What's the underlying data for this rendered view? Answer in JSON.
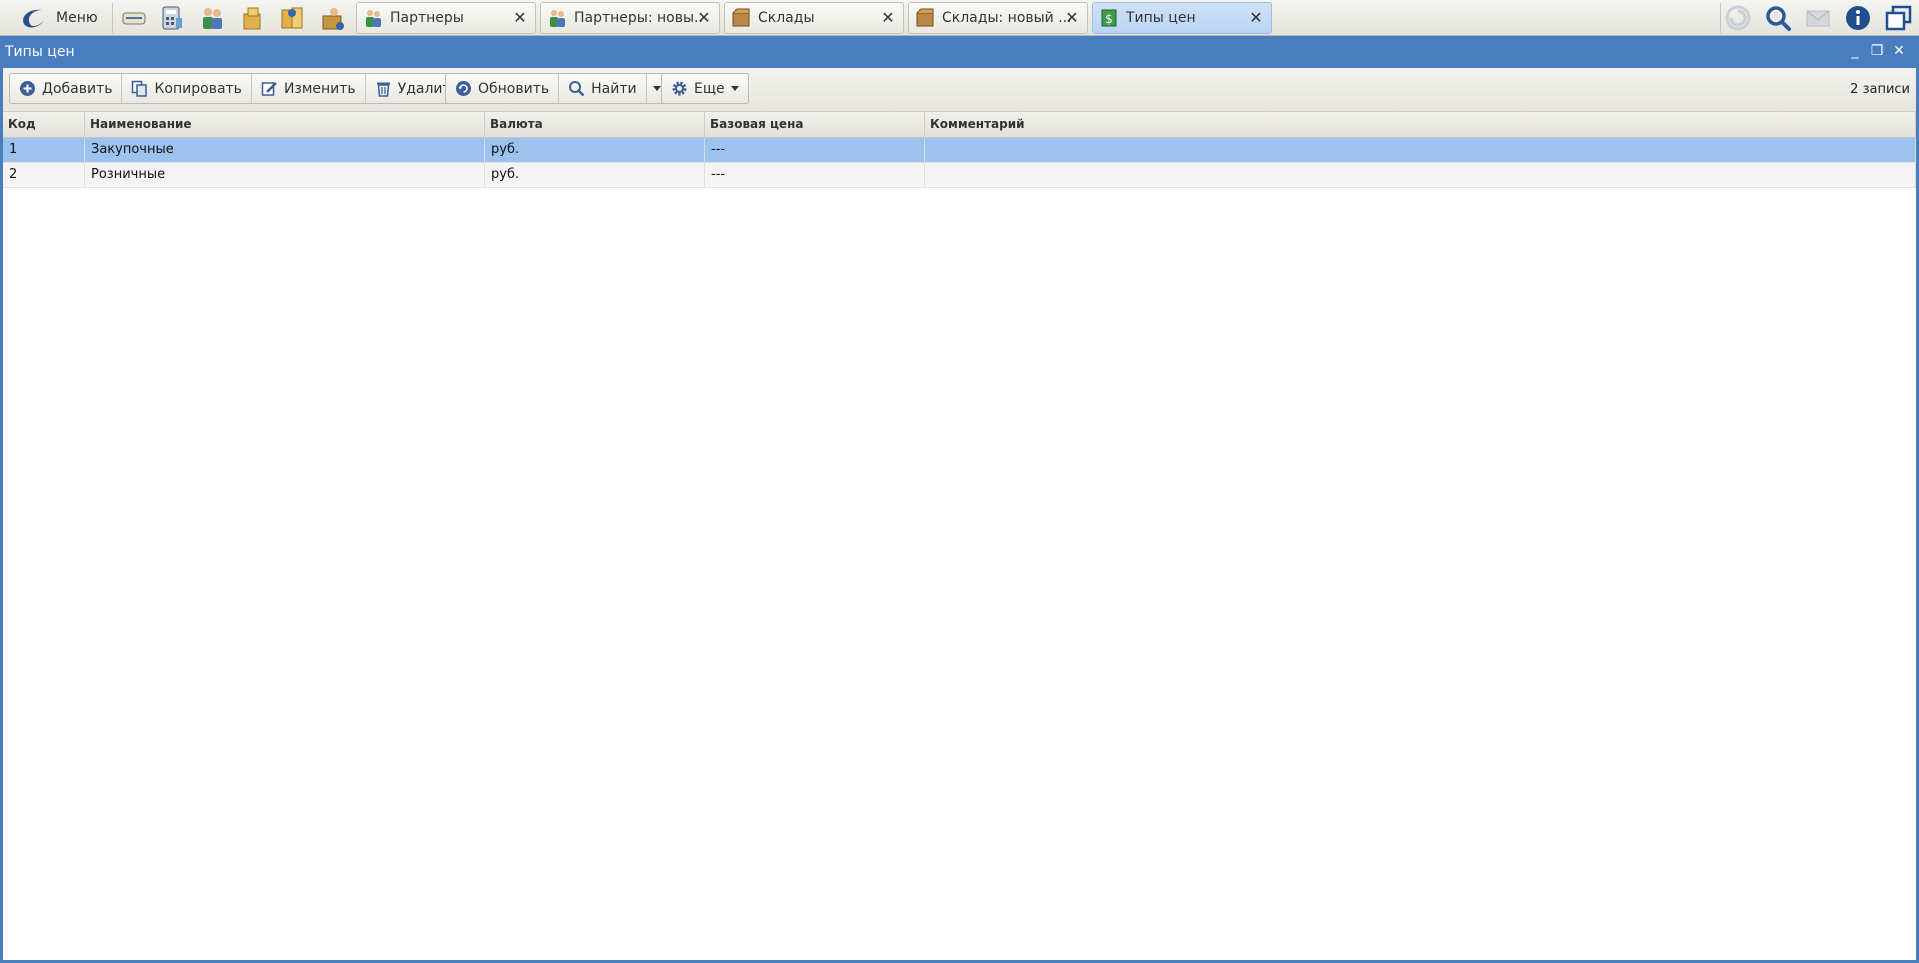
{
  "taskbar": {
    "menu_label": "Меню",
    "quick_icons": [
      "handshake-icon",
      "calculator-icon",
      "partners-icon",
      "goods-icon",
      "documents-icon",
      "warehouse-icon"
    ],
    "tabs": [
      {
        "label": "Партнеры",
        "icon": "partners-icon",
        "active": false
      },
      {
        "label": "Партнеры: новы...",
        "icon": "partners-icon",
        "active": false
      },
      {
        "label": "Склады",
        "icon": "box-icon",
        "active": false
      },
      {
        "label": "Склады: новый ...",
        "icon": "box-icon",
        "active": false
      },
      {
        "label": "Типы цен",
        "icon": "price-icon",
        "active": true
      }
    ],
    "right_icons": [
      "refresh-icon",
      "search-icon",
      "mail-icon",
      "info-icon",
      "windows-icon"
    ]
  },
  "window": {
    "title": "Типы цен"
  },
  "toolbar": {
    "add_label": "Добавить",
    "copy_label": "Копировать",
    "edit_label": "Изменить",
    "delete_label": "Удалить",
    "refresh_label": "Обновить",
    "find_label": "Найти",
    "more_label": "Еще",
    "records_label": "2 записи"
  },
  "table": {
    "columns": [
      "Код",
      "Наименование",
      "Валюта",
      "Базовая цена",
      "Комментарий"
    ],
    "rows": [
      {
        "code": "1",
        "name": "Закупочные",
        "currency": "руб.",
        "base_price": "---",
        "comment": "",
        "selected": true
      },
      {
        "code": "2",
        "name": "Розничные",
        "currency": "руб.",
        "base_price": "---",
        "comment": "",
        "selected": false
      }
    ]
  },
  "colors": {
    "accent": "#4a7cc0",
    "selected_row": "#9cc3ef",
    "active_tab": "#c3dbf5"
  }
}
